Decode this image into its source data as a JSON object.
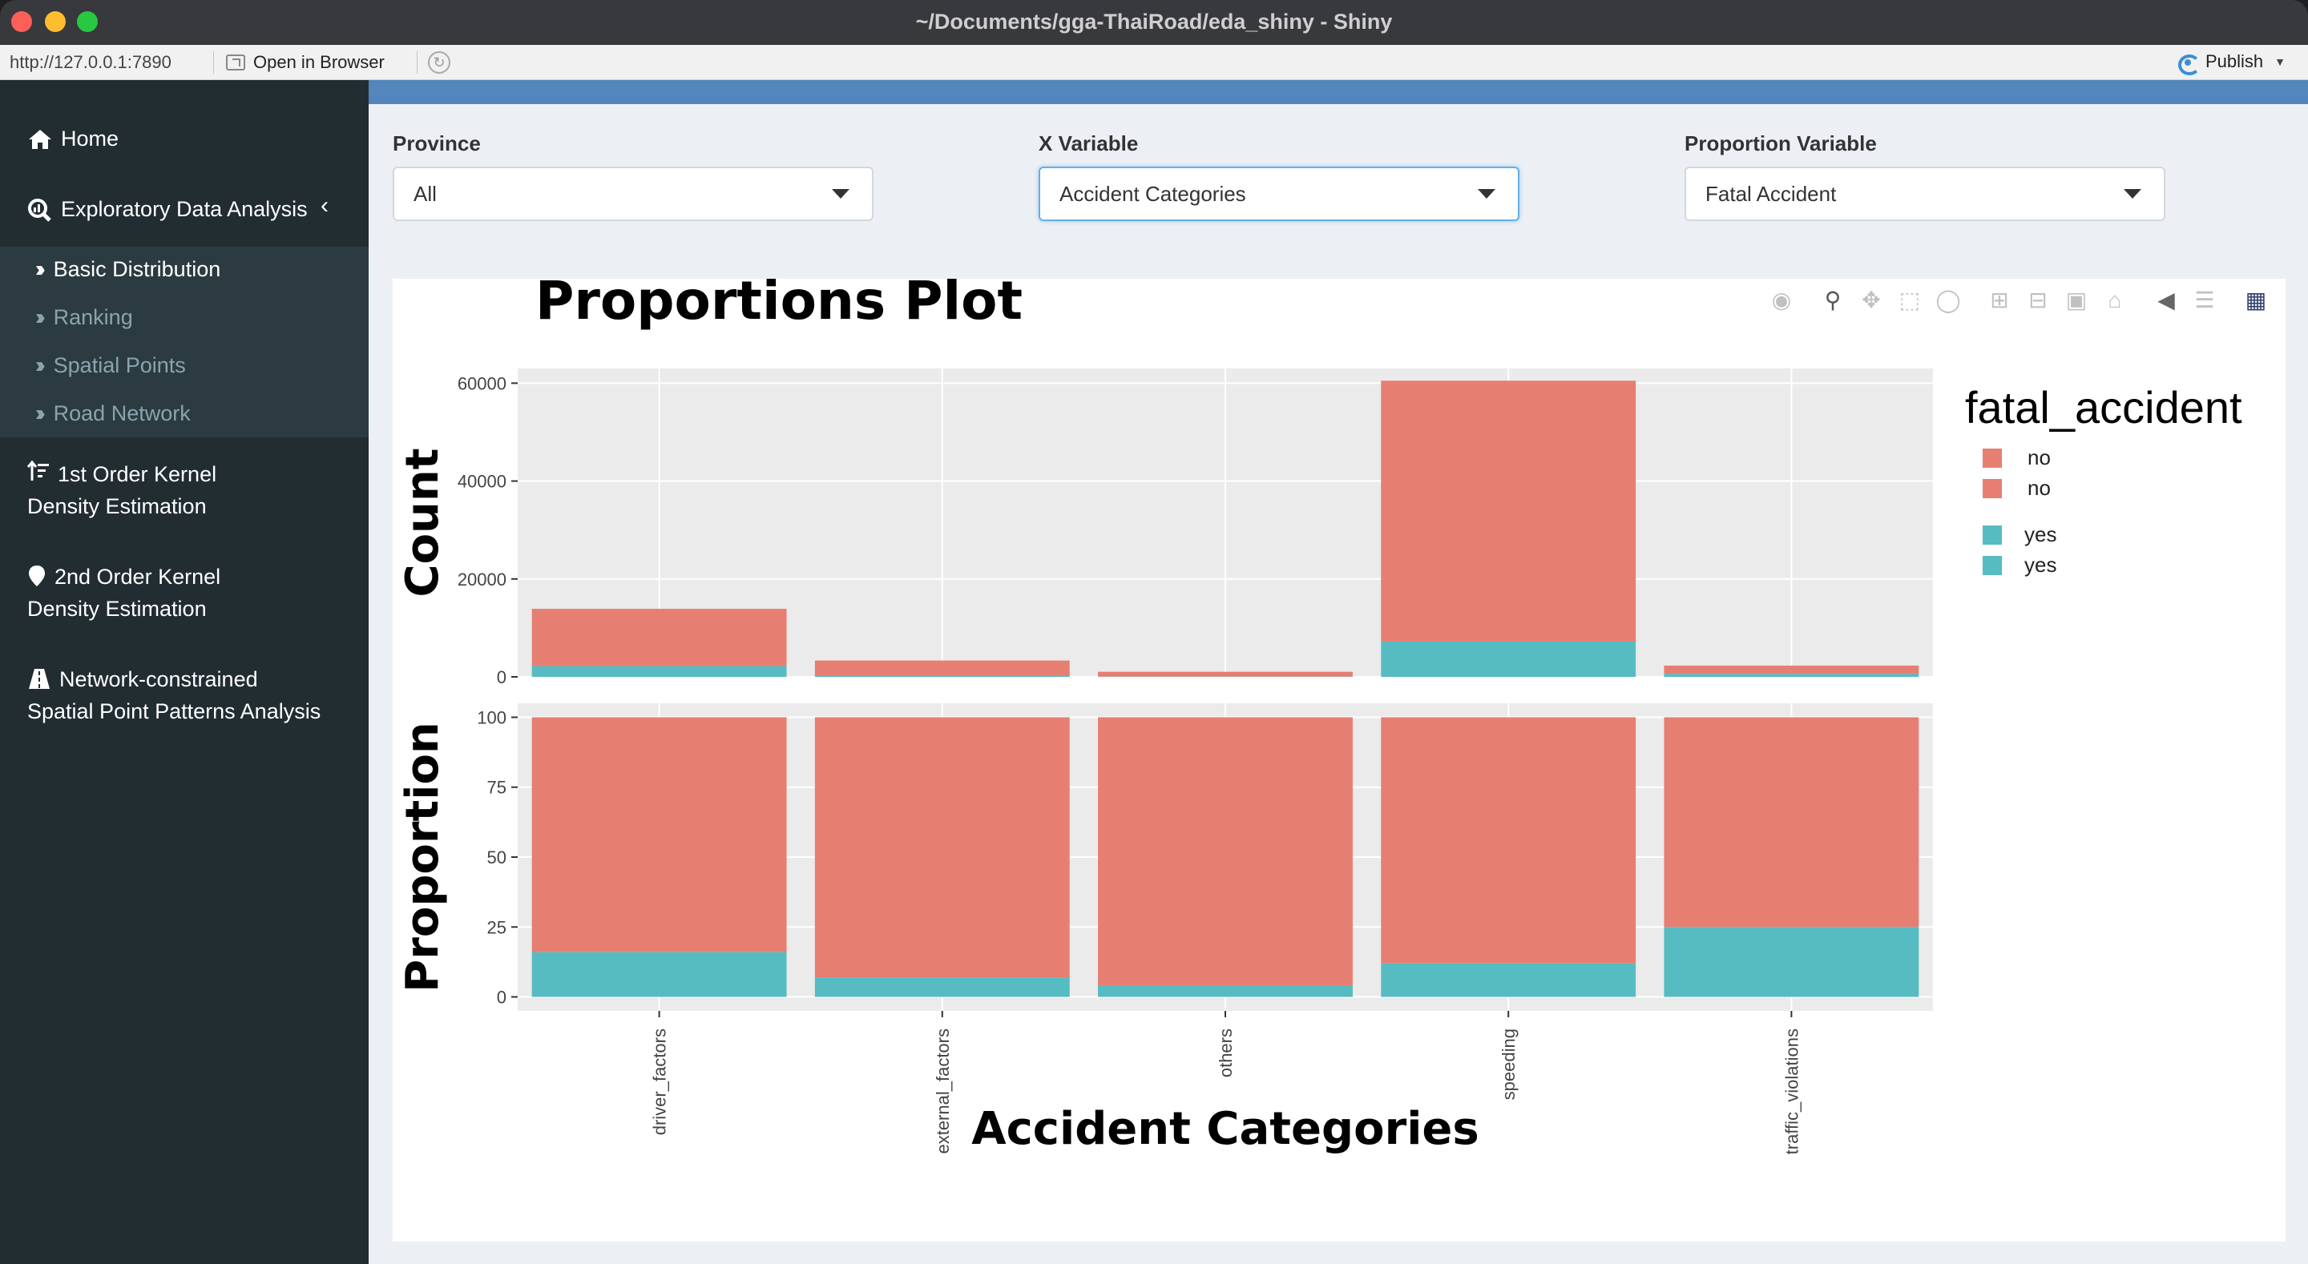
{
  "window": {
    "title": "~/Documents/gga-ThaiRoad/eda_shiny - Shiny"
  },
  "toolbar": {
    "url": "http://127.0.0.1:7890",
    "open_in_browser": "Open in Browser",
    "publish": "Publish"
  },
  "sidebar": {
    "home": "Home",
    "eda": "Exploratory Data Analysis",
    "sub_items": [
      "Basic Distribution",
      "Ranking",
      "Spatial Points",
      "Road Network"
    ],
    "kde1_line1": "1st Order Kernel",
    "kde1_line2": "Density Estimation",
    "kde2_line1": "2nd Order Kernel",
    "kde2_line2": "Density Estimation",
    "net_line1": "Network-constrained",
    "net_line2": "Spatial Point Patterns Analysis"
  },
  "controls": {
    "province_label": "Province",
    "province_value": "All",
    "xvar_label": "X Variable",
    "xvar_value": "Accident Categories",
    "propvar_label": "Proportion Variable",
    "propvar_value": "Fatal Accident"
  },
  "colors": {
    "no": "#e77e72",
    "yes": "#56bcc2",
    "panel_bg": "#ebebeb",
    "header_blue": "#5286bd",
    "sidebar_bg": "#222d32"
  },
  "modebar_icons": [
    "camera-icon",
    "zoom-icon",
    "pan-icon",
    "box-select-icon",
    "lasso-icon",
    "zoom-in-icon",
    "zoom-out-icon",
    "autoscale-icon",
    "reset-axes-icon",
    "spike-lines-icon",
    "compare-hover-icon",
    "plotly-logo-icon"
  ],
  "chart_data": [
    {
      "type": "bar",
      "stacked": true,
      "title": "Proportions Plot",
      "xlabel": "",
      "ylabel": "Count",
      "categories": [
        "driver_factors",
        "external_factors",
        "others",
        "speeding",
        "traffic_violations"
      ],
      "series": [
        {
          "name": "no",
          "values": [
            11700,
            3100,
            1000,
            53300,
            1700
          ]
        },
        {
          "name": "yes",
          "values": [
            2200,
            240,
            40,
            7200,
            600
          ]
        }
      ],
      "ylim": [
        0,
        63000
      ],
      "yticks": [
        0,
        20000,
        40000,
        60000
      ],
      "ytick_labels": [
        "0",
        "20000",
        "40000",
        "60000"
      ],
      "grid": true
    },
    {
      "type": "bar",
      "stacked": true,
      "xlabel": "Accident Categories",
      "ylabel": "Proportion",
      "categories": [
        "driver_factors",
        "external_factors",
        "others",
        "speeding",
        "traffic_violations"
      ],
      "series": [
        {
          "name": "no",
          "values": [
            84,
            93,
            96,
            88,
            75
          ]
        },
        {
          "name": "yes",
          "values": [
            16,
            7,
            4,
            12,
            25
          ]
        }
      ],
      "ylim": [
        -5,
        105
      ],
      "yticks": [
        0,
        25,
        50,
        75,
        100
      ],
      "ytick_labels": [
        "0",
        "25",
        "50",
        "75",
        "100"
      ],
      "grid": true
    }
  ],
  "legend": {
    "title": "fatal_accident",
    "entries": [
      "no",
      "no",
      "yes",
      "yes"
    ],
    "placement": "right"
  }
}
